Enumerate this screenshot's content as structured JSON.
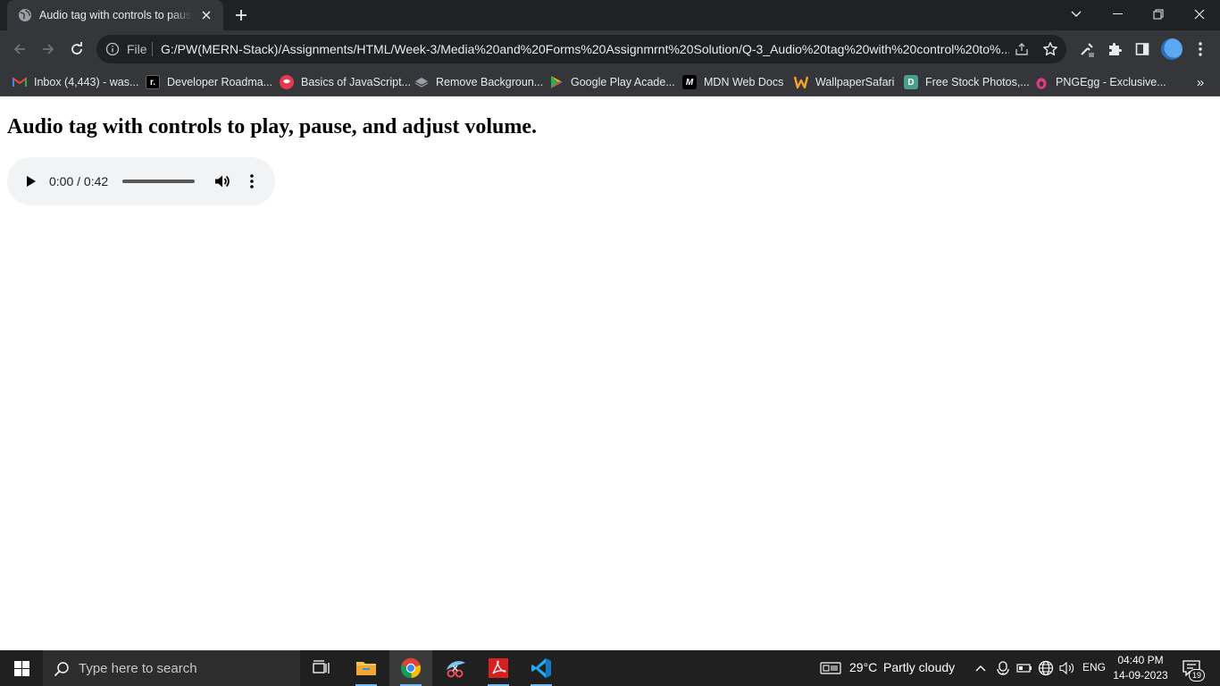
{
  "browser": {
    "tab": {
      "title": "Audio tag with controls to pause, play, and adjust volume."
    },
    "address_bar": {
      "scheme_label": "File",
      "url": "G:/PW(MERN-Stack)/Assignments/HTML/Week-3/Media%20and%20Forms%20Assignmrnt%20Solution/Q-3_Audio%20tag%20with%20control%20to%..."
    },
    "bookmarks": [
      {
        "label": "Inbox (4,443) - was...",
        "icon": "gmail-icon",
        "color": "#ea4335"
      },
      {
        "label": "Developer Roadma...",
        "icon": "roadmap-icon",
        "color": "#000000"
      },
      {
        "label": "Basics of JavaScript...",
        "icon": "js-basics-icon",
        "color": "#e53950"
      },
      {
        "label": "Remove Backgroun...",
        "icon": "remove-bg-icon",
        "color": "#9aa0a6"
      },
      {
        "label": "Google Play Acade...",
        "icon": "google-play-icon",
        "color": "#34a853"
      },
      {
        "label": "MDN Web Docs",
        "icon": "mdn-icon",
        "color": "#000000"
      },
      {
        "label": "WallpaperSafari",
        "icon": "wallpapersafari-icon",
        "color": "#f5a623"
      },
      {
        "label": "Free Stock Photos,...",
        "icon": "stock-photos-icon",
        "color": "#4a9d8f"
      },
      {
        "label": "PNGEgg - Exclusive...",
        "icon": "pngegg-icon",
        "color": "#e03a84"
      }
    ]
  },
  "page": {
    "heading": "Audio tag with controls to play, pause, and adjust volume.",
    "audio": {
      "time": "0:00 / 0:42",
      "progress": 0
    }
  },
  "taskbar": {
    "search_placeholder": "Type here to search",
    "weather": {
      "temp": "29°C",
      "condition": "Partly cloudy"
    },
    "language": "ENG",
    "time": "04:40 PM",
    "date": "14-09-2023",
    "notification_count": "19"
  }
}
